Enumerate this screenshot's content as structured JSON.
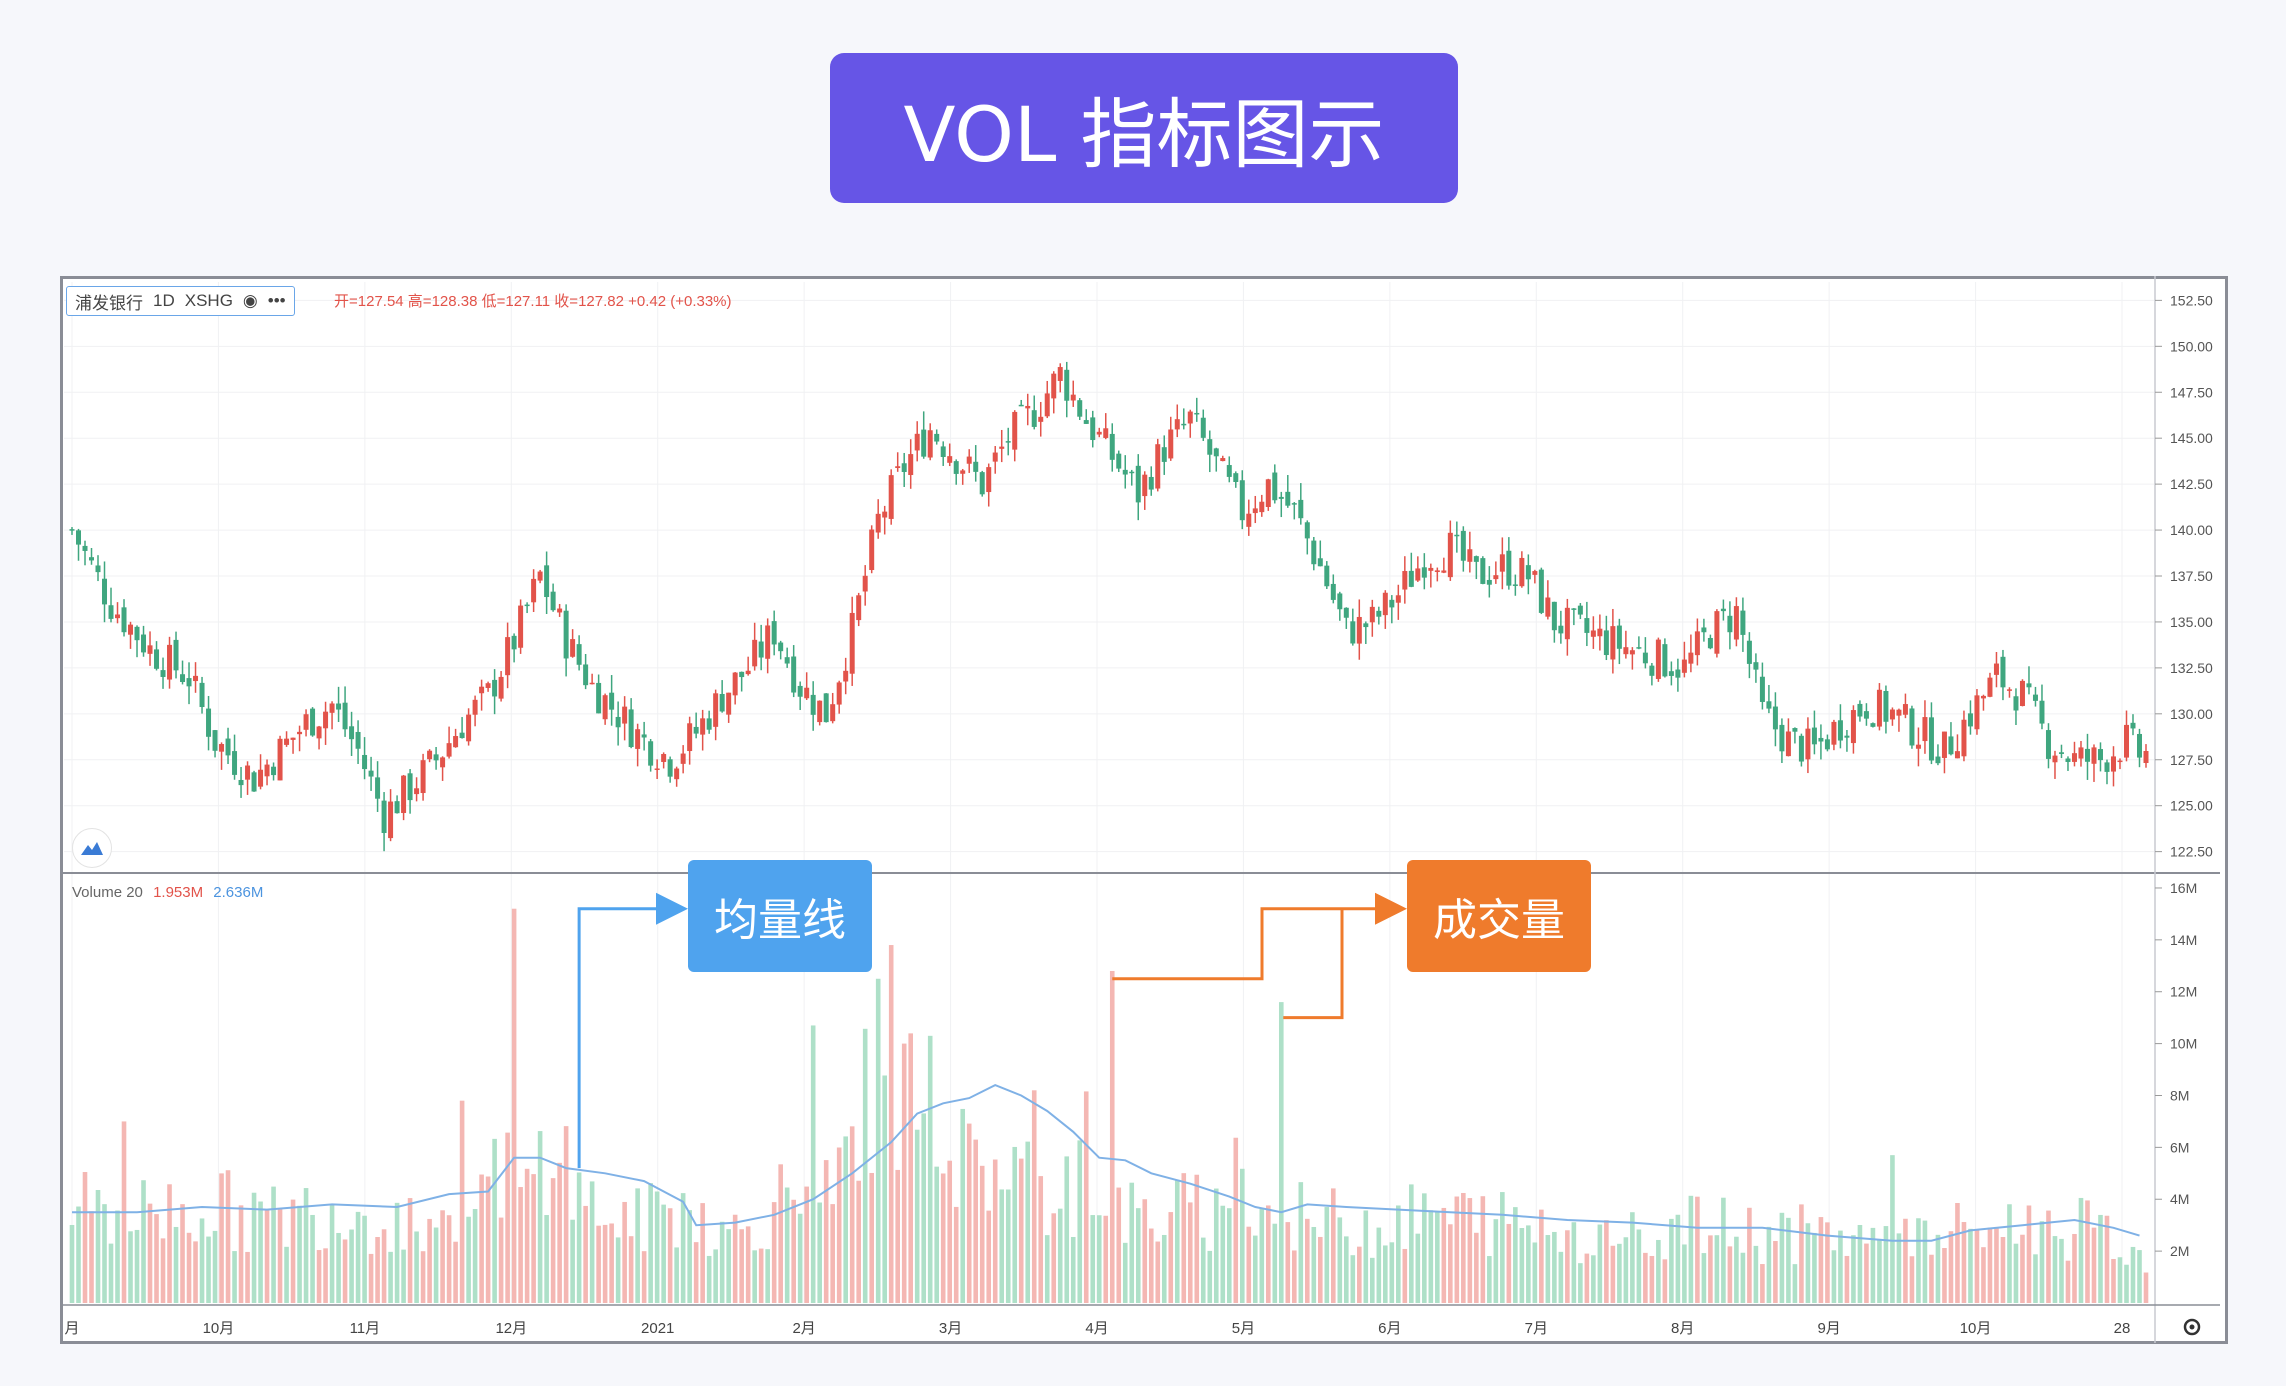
{
  "title": "VOL 指标图示",
  "legend": {
    "symbol": "浦发银行",
    "interval": "1D",
    "exchange": "XSHG",
    "eye_icon": "eye-icon",
    "more_icon": "more-icon",
    "ohlc": "开=127.54 高=128.38 低=127.11 收=127.82 +0.42 (+0.33%)"
  },
  "volume_legend": {
    "name": "Volume 20",
    "value1": "1.953M",
    "value2": "2.636M"
  },
  "callouts": {
    "ma": "均量线",
    "volume": "成交量"
  },
  "colors": {
    "up": "#e2534a",
    "down": "#3fa67f",
    "vol_up": "#f4b7b3",
    "vol_down": "#aee0c8",
    "ma": "#7fb1e6",
    "ma_callout": "#4fa3ee",
    "vol_callout": "#ef7b2c",
    "banner": "#6655e6"
  },
  "chart_data": {
    "type": "candlestick+volume",
    "price_axis": [
      "152.50",
      "150.00",
      "147.50",
      "145.00",
      "142.50",
      "140.00",
      "137.50",
      "135.00",
      "132.50",
      "130.00",
      "127.50",
      "125.00",
      "122.50"
    ],
    "volume_axis": [
      "16M",
      "14M",
      "12M",
      "10M",
      "8M",
      "6M",
      "4M",
      "2M"
    ],
    "x_labels": [
      "月",
      "10月",
      "11月",
      "12月",
      "2021",
      "2月",
      "3月",
      "4月",
      "5月",
      "6月",
      "7月",
      "8月",
      "9月",
      "10月",
      "28"
    ],
    "price_ylim": [
      121.5,
      153.5
    ],
    "volume_ylim": [
      0,
      16.5
    ],
    "close_trend": [
      [
        0,
        140.0
      ],
      [
        6,
        136.0
      ],
      [
        12,
        133.5
      ],
      [
        18,
        132.0
      ],
      [
        22,
        128.5
      ],
      [
        28,
        126.5
      ],
      [
        32,
        128.0
      ],
      [
        36,
        129.5
      ],
      [
        40,
        130.5
      ],
      [
        44,
        128.0
      ],
      [
        48,
        124.5
      ],
      [
        52,
        126.0
      ],
      [
        56,
        127.5
      ],
      [
        60,
        129.5
      ],
      [
        64,
        131.0
      ],
      [
        68,
        134.0
      ],
      [
        72,
        137.5
      ],
      [
        76,
        134.0
      ],
      [
        80,
        131.5
      ],
      [
        84,
        130.0
      ],
      [
        88,
        128.5
      ],
      [
        92,
        127.5
      ],
      [
        96,
        129.0
      ],
      [
        100,
        131.0
      ],
      [
        104,
        132.5
      ],
      [
        108,
        134.5
      ],
      [
        112,
        131.5
      ],
      [
        116,
        130.0
      ],
      [
        120,
        134.5
      ],
      [
        124,
        140.5
      ],
      [
        128,
        143.5
      ],
      [
        132,
        145.5
      ],
      [
        136,
        144.0
      ],
      [
        140,
        142.5
      ],
      [
        144,
        145.0
      ],
      [
        148,
        146.5
      ],
      [
        152,
        148.5
      ],
      [
        156,
        146.0
      ],
      [
        160,
        144.0
      ],
      [
        164,
        142.0
      ],
      [
        168,
        144.5
      ],
      [
        172,
        146.0
      ],
      [
        176,
        143.5
      ],
      [
        180,
        141.0
      ],
      [
        184,
        142.5
      ],
      [
        188,
        141.0
      ],
      [
        192,
        138.0
      ],
      [
        196,
        134.5
      ],
      [
        200,
        135.0
      ],
      [
        204,
        136.5
      ],
      [
        208,
        138.5
      ],
      [
        212,
        139.0
      ],
      [
        216,
        137.5
      ],
      [
        220,
        138.0
      ],
      [
        224,
        137.5
      ],
      [
        228,
        135.0
      ],
      [
        232,
        134.5
      ],
      [
        236,
        134.0
      ],
      [
        240,
        133.5
      ],
      [
        244,
        133.0
      ],
      [
        248,
        132.5
      ],
      [
        252,
        134.5
      ],
      [
        256,
        135.5
      ],
      [
        260,
        130.0
      ],
      [
        264,
        128.5
      ],
      [
        268,
        128.0
      ],
      [
        272,
        129.5
      ],
      [
        276,
        130.5
      ],
      [
        280,
        130.0
      ],
      [
        284,
        129.0
      ],
      [
        288,
        128.0
      ],
      [
        292,
        130.0
      ],
      [
        296,
        132.0
      ],
      [
        300,
        131.0
      ],
      [
        304,
        128.5
      ],
      [
        308,
        127.5
      ],
      [
        312,
        127.5
      ],
      [
        316,
        128.5
      ],
      [
        318,
        127.8
      ]
    ],
    "volume_trend": [
      [
        0,
        3.5
      ],
      [
        10,
        3.5
      ],
      [
        20,
        3.8
      ],
      [
        30,
        3.2
      ],
      [
        40,
        3.7
      ],
      [
        50,
        3.2
      ],
      [
        60,
        3.4
      ],
      [
        66,
        5.0
      ],
      [
        70,
        4.2
      ],
      [
        72,
        5.5
      ],
      [
        74,
        6.8
      ],
      [
        78,
        4.0
      ],
      [
        82,
        3.5
      ],
      [
        86,
        3.0
      ],
      [
        90,
        3.4
      ],
      [
        96,
        3.8
      ],
      [
        100,
        2.5
      ],
      [
        104,
        3.0
      ],
      [
        110,
        4.2
      ],
      [
        114,
        5.0
      ],
      [
        118,
        4.5
      ],
      [
        122,
        8.0
      ],
      [
        126,
        7.0
      ],
      [
        130,
        8.5
      ],
      [
        134,
        6.5
      ],
      [
        138,
        5.0
      ],
      [
        142,
        5.5
      ],
      [
        146,
        5.0
      ],
      [
        150,
        4.2
      ],
      [
        154,
        4.0
      ],
      [
        156,
        6.0
      ],
      [
        160,
        3.5
      ],
      [
        166,
        3.2
      ],
      [
        170,
        3.6
      ],
      [
        176,
        3.4
      ],
      [
        178,
        5.5
      ],
      [
        182,
        3.5
      ],
      [
        190,
        3.2
      ],
      [
        200,
        3.0
      ],
      [
        210,
        3.4
      ],
      [
        220,
        3.1
      ],
      [
        230,
        2.8
      ],
      [
        240,
        2.7
      ],
      [
        250,
        2.9
      ],
      [
        260,
        2.7
      ],
      [
        270,
        2.6
      ],
      [
        280,
        2.4
      ],
      [
        286,
        2.5
      ],
      [
        290,
        2.7
      ],
      [
        300,
        3.0
      ],
      [
        310,
        2.8
      ],
      [
        318,
        2.0
      ]
    ],
    "volume_spikes": [
      [
        8,
        7.0
      ],
      [
        60,
        7.8
      ],
      [
        68,
        15.2
      ],
      [
        114,
        10.7
      ],
      [
        124,
        12.5
      ],
      [
        126,
        13.8
      ],
      [
        128,
        10.0
      ],
      [
        132,
        10.3
      ],
      [
        148,
        8.2
      ],
      [
        160,
        12.8
      ],
      [
        186,
        11.6
      ],
      [
        240,
        3.5
      ],
      [
        280,
        5.7
      ]
    ],
    "ma_line": [
      [
        0,
        3.5
      ],
      [
        10,
        3.5
      ],
      [
        20,
        3.7
      ],
      [
        30,
        3.6
      ],
      [
        40,
        3.8
      ],
      [
        50,
        3.7
      ],
      [
        58,
        4.2
      ],
      [
        64,
        4.3
      ],
      [
        68,
        5.6
      ],
      [
        72,
        5.6
      ],
      [
        76,
        5.2
      ],
      [
        82,
        5.0
      ],
      [
        88,
        4.7
      ],
      [
        94,
        3.9
      ],
      [
        96,
        3.0
      ],
      [
        102,
        3.1
      ],
      [
        108,
        3.4
      ],
      [
        114,
        4.0
      ],
      [
        120,
        5.0
      ],
      [
        126,
        6.2
      ],
      [
        130,
        7.3
      ],
      [
        134,
        7.7
      ],
      [
        138,
        7.9
      ],
      [
        142,
        8.4
      ],
      [
        146,
        8.0
      ],
      [
        150,
        7.4
      ],
      [
        154,
        6.6
      ],
      [
        158,
        5.6
      ],
      [
        162,
        5.5
      ],
      [
        166,
        5.0
      ],
      [
        172,
        4.6
      ],
      [
        178,
        4.1
      ],
      [
        182,
        3.7
      ],
      [
        186,
        3.5
      ],
      [
        190,
        3.8
      ],
      [
        196,
        3.7
      ],
      [
        204,
        3.6
      ],
      [
        212,
        3.5
      ],
      [
        220,
        3.4
      ],
      [
        230,
        3.2
      ],
      [
        240,
        3.1
      ],
      [
        250,
        2.9
      ],
      [
        260,
        2.9
      ],
      [
        270,
        2.6
      ],
      [
        280,
        2.4
      ],
      [
        286,
        2.4
      ],
      [
        292,
        2.8
      ],
      [
        300,
        3.0
      ],
      [
        308,
        3.2
      ],
      [
        314,
        2.9
      ],
      [
        318,
        2.6
      ]
    ]
  }
}
